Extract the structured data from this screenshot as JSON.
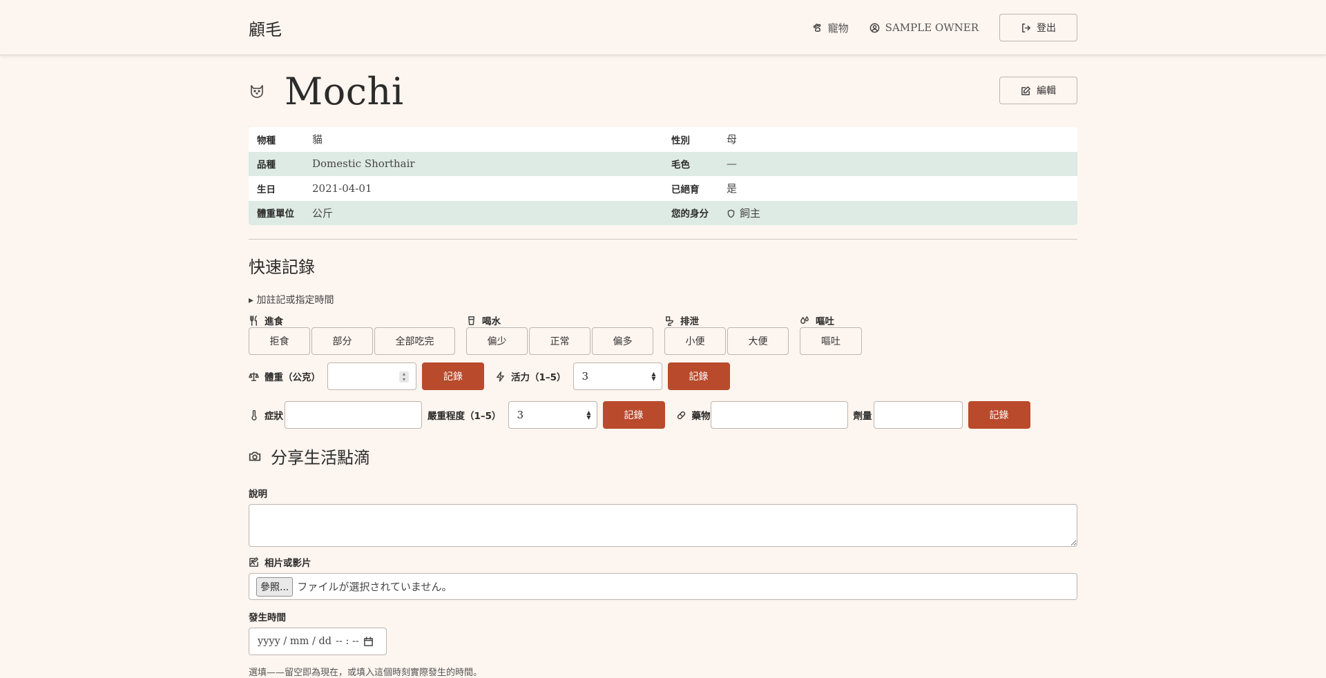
{
  "header": {
    "brand": "顧毛",
    "nav_pets": "寵物",
    "nav_user": "SAMPLE OWNER",
    "logout": "登出"
  },
  "pet": {
    "name": "Mochi",
    "edit": "編輯",
    "info": [
      {
        "label": "物種",
        "value": "貓",
        "label2": "性別",
        "value2": "母"
      },
      {
        "label": "品種",
        "value": "Domestic Shorthair",
        "label2": "毛色",
        "value2": "—"
      },
      {
        "label": "生日",
        "value": "2021-04-01",
        "label2": "已絕育",
        "value2": "是"
      },
      {
        "label": "體重單位",
        "value": "公斤",
        "label2": "您的身分",
        "value2": "飼主"
      }
    ]
  },
  "quick": {
    "title": "快速記錄",
    "details_toggle": "▸ 加註記或指定時間",
    "food": {
      "label": "進食",
      "options": [
        "拒食",
        "部分",
        "全部吃完"
      ]
    },
    "water": {
      "label": "喝水",
      "options": [
        "偏少",
        "正常",
        "偏多"
      ]
    },
    "toilet": {
      "label": "排泄",
      "options": [
        "小便",
        "大便"
      ]
    },
    "vomit": {
      "label": "嘔吐",
      "options": [
        "嘔吐"
      ]
    },
    "weight": {
      "label": "體重（公克）",
      "value": ""
    },
    "energy": {
      "label": "活力（1–5）",
      "value": "3"
    },
    "symptom": {
      "label": "症狀",
      "value": ""
    },
    "severity": {
      "label": "嚴重程度（1–5）",
      "value": "3"
    },
    "medicine": {
      "label": "藥物",
      "value": ""
    },
    "dose": {
      "label": "劑量",
      "value": ""
    },
    "record": "記錄"
  },
  "share": {
    "title": "分享生活點滴",
    "desc_label": "說明",
    "media_label": "相片或影片",
    "browse": "參照...",
    "no_file": "ファイルが選択されていません。",
    "time_label": "發生時間",
    "date_placeholder": "yyyy / mm / dd",
    "time_placeholder": "-- : --",
    "hint": "選填——留空即為現在，或填入這個時刻實際發生的時間。"
  }
}
